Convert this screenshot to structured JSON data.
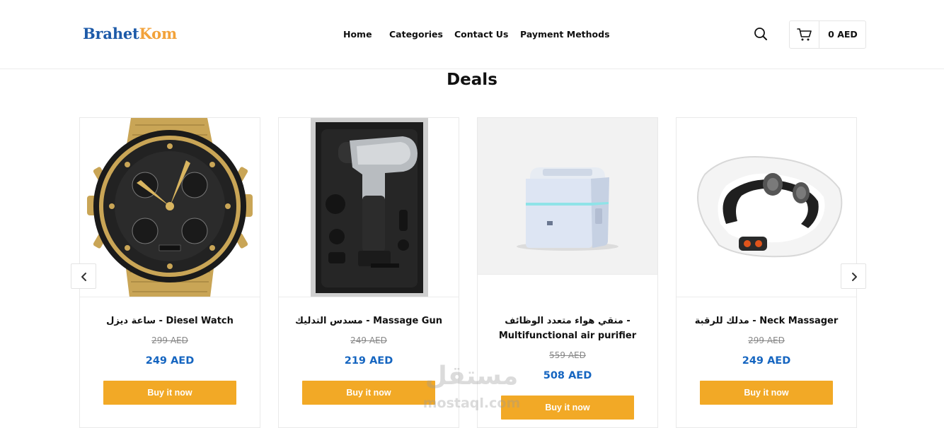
{
  "header": {
    "logo_part1": "Brahet",
    "logo_part2": "Kom",
    "nav": [
      "Home",
      "Categories",
      "Contact Us",
      "Payment Methods"
    ],
    "cart_total": "0 AED",
    "search_icon": "search-icon",
    "cart_icon": "shopping-cart-icon"
  },
  "section": {
    "title": "Deals"
  },
  "products": [
    {
      "name": "ساعة ديزل - Diesel Watch",
      "old_price": "299 AED",
      "new_price": "249 AED",
      "button": "Buy it now"
    },
    {
      "name": "مسدس التدليك - Massage Gun",
      "old_price": "249 AED",
      "new_price": "219 AED",
      "button": "Buy it now"
    },
    {
      "name": "منقي هواء متعدد الوظائف - Multifunctional air purifier",
      "old_price": "559 AED",
      "new_price": "508 AED",
      "button": "Buy it now"
    },
    {
      "name": "مدلك للرقبة - Neck Massager",
      "old_price": "299 AED",
      "new_price": "249 AED",
      "button": "Buy it now"
    }
  ],
  "carousel": {
    "prev_icon": "chevron-left-icon",
    "next_icon": "chevron-right-icon"
  },
  "watermark": {
    "arabic": "مستقل",
    "latin": "mostaql.com"
  },
  "colors": {
    "brand_blue": "#1d5aa8",
    "brand_orange": "#f2a23a",
    "button": "#f2a926",
    "price": "#1565c0"
  }
}
